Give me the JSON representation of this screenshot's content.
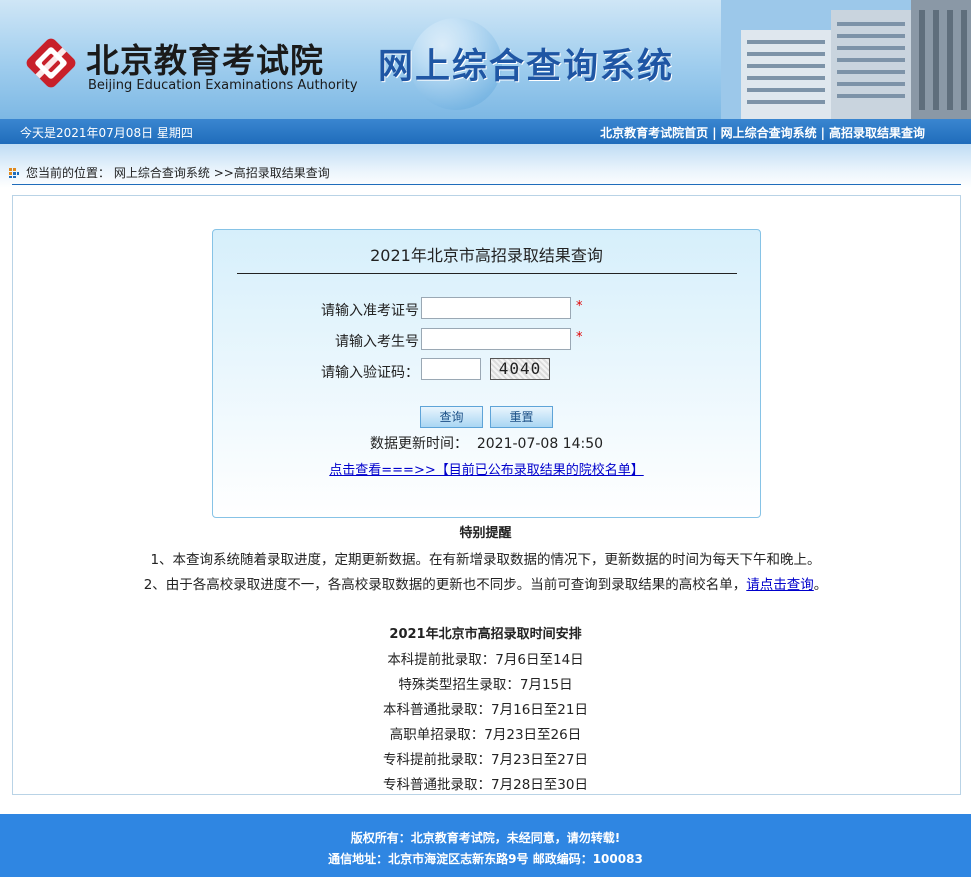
{
  "header": {
    "logo_cn": "北京教育考试院",
    "logo_en": "Beijing Education Examinations Authority",
    "system_title": "网上综合查询系统"
  },
  "topbar": {
    "date_text": "今天是2021年07月08日  星期四",
    "links": [
      "北京教育考试院首页",
      "网上综合查询系统",
      "高招录取结果查询"
    ],
    "separator": "|"
  },
  "breadcrumb": {
    "prefix": "您当前的位置：",
    "items": [
      "网上综合查询系统",
      ">>高招录取结果查询"
    ]
  },
  "query": {
    "title": "2021年北京市高招录取结果查询",
    "ticket_label": "请输入准考证号",
    "ticket_value": "",
    "student_label": "请输入考生号",
    "student_value": "",
    "captcha_label": "请输入验证码：",
    "captcha_value": "",
    "captcha_image_text": "4040",
    "required_mark": "*",
    "submit_label": "查询",
    "reset_label": "重置",
    "update_label": "数据更新时间：",
    "update_time": "2021-07-08 14:50",
    "school_list_link": "点击查看===>>【目前已公布录取结果的院校名单】"
  },
  "notice": {
    "title": "特别提醒",
    "item1": "1、本查询系统随着录取进度，定期更新数据。在有新增录取数据的情况下，更新数据的时间为每天下午和晚上。",
    "item2_text": "2、由于各高校录取进度不一，各高校录取数据的更新也不同步。当前可查询到录取结果的高校名单，",
    "item2_link": "请点击查询",
    "item2_end": "。"
  },
  "schedule": {
    "title": "2021年北京市高招录取时间安排",
    "items": [
      "本科提前批录取：7月6日至14日",
      "特殊类型招生录取：7月15日",
      "本科普通批录取：7月16日至21日",
      "高职单招录取：7月23日至26日",
      "专科提前批录取：7月23日至27日",
      "专科普通批录取：7月28日至30日"
    ]
  },
  "footer": {
    "copyright": "版权所有：北京教育考试院，未经同意，请勿转载!",
    "address": "通信地址：北京市海淀区志新东路9号  邮政编码：100083"
  },
  "colors": {
    "topbar": "#1f6cbb",
    "footer": "#2f86e2",
    "title_blue": "#1f56a4",
    "link": "#0000cc",
    "required": "#e00000"
  }
}
